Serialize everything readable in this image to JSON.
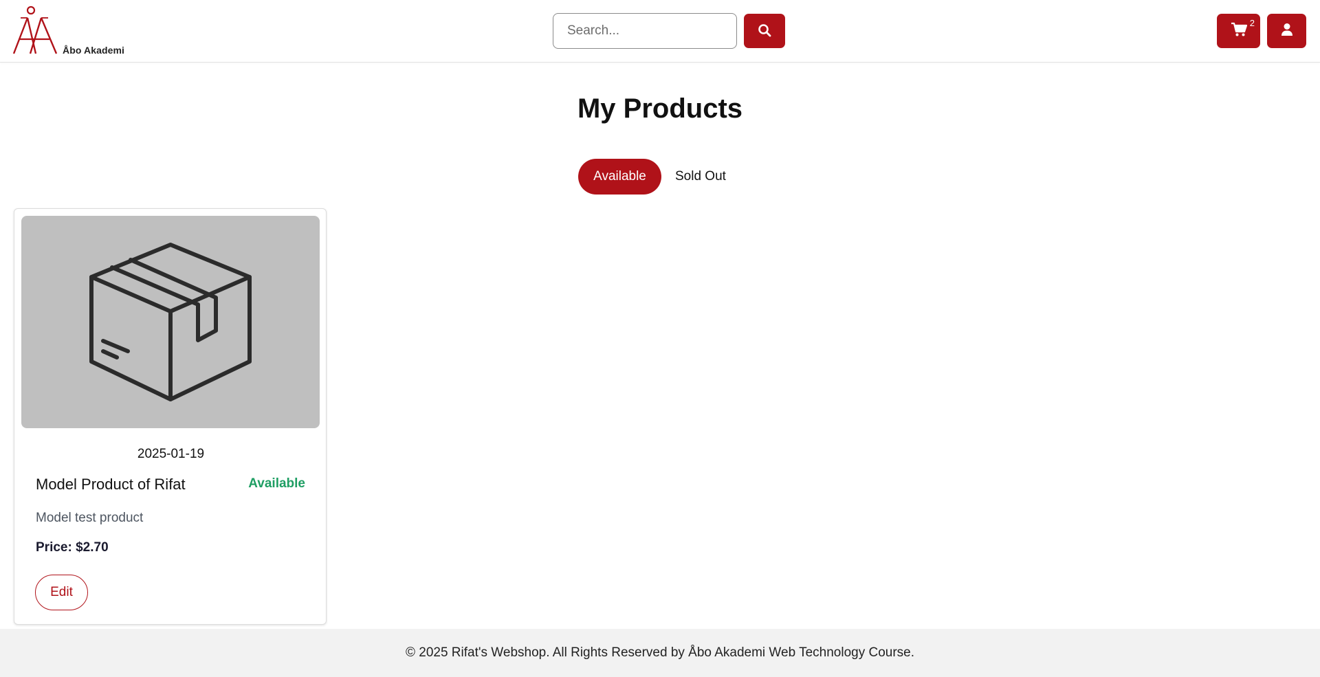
{
  "header": {
    "logo_text": "Åbo Akademi",
    "search_placeholder": "Search...",
    "search_value": "",
    "cart_count": "2"
  },
  "main": {
    "title": "My Products",
    "tabs": [
      {
        "label": "Available",
        "active": true
      },
      {
        "label": "Sold Out",
        "active": false
      }
    ],
    "products": [
      {
        "date": "2025-01-19",
        "name": "Model Product of Rifat",
        "status": "Available",
        "description": "Model test product",
        "price": "Price: $2.70",
        "edit_label": "Edit",
        "image_icon": "box-icon"
      }
    ]
  },
  "footer": {
    "text": "© 2025 Rifat's Webshop. All Rights Reserved by Åbo Akademi Web Technology Course."
  },
  "colors": {
    "brand": "#b01219",
    "status_available": "#1e9e63",
    "placeholder_bg": "#bfbfbf",
    "footer_bg": "#f2f2f2"
  }
}
